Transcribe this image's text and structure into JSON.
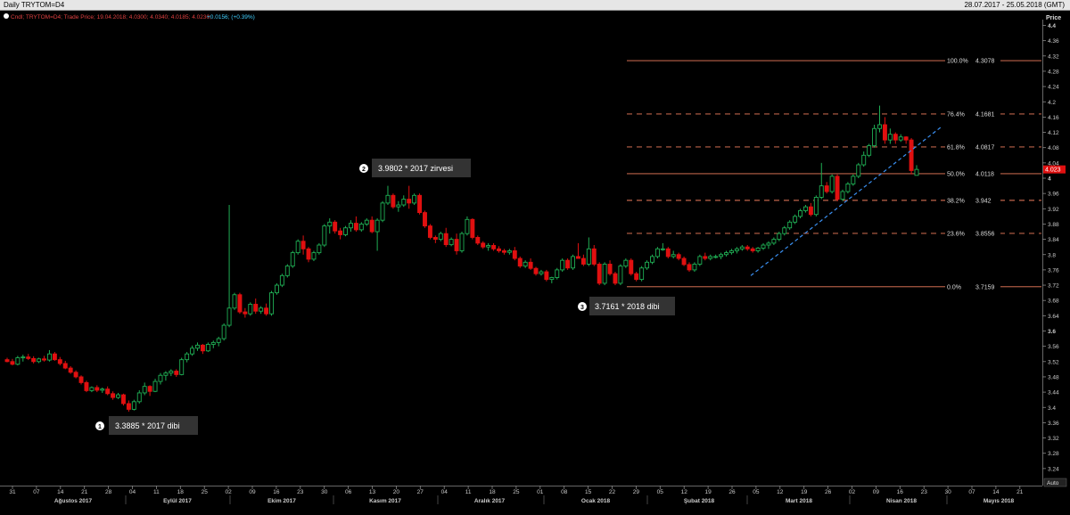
{
  "window": {
    "title": "Daily TRYTOM=D4",
    "date_range": "28.07.2017 - 25.05.2018 (GMT)"
  },
  "legend_line": {
    "prefix": "Cndl; TRYTOM=D4; Trade Price; 19.04.2018; 4.0300; 4.0340; 4.0185; 4.0230;",
    "change": "+0.0156; (+0.39%)"
  },
  "axis": {
    "price_label": "Price",
    "auto_label": "Auto",
    "last_price_tag": "4.023",
    "price_ticks": [
      "4.4",
      "4.36",
      "4.32",
      "4.28",
      "4.24",
      "4.2",
      "4.16",
      "4.12",
      "4.08",
      "4.04",
      "4",
      "3.96",
      "3.92",
      "3.88",
      "3.84",
      "3.8",
      "3.76",
      "3.72",
      "3.68",
      "3.64",
      "3.6",
      "3.56",
      "3.52",
      "3.48",
      "3.44",
      "3.4",
      "3.36",
      "3.32",
      "3.28",
      "3.24"
    ],
    "date_ticks": [
      "31",
      "07",
      "14",
      "21",
      "28",
      "04",
      "11",
      "18",
      "25",
      "02",
      "09",
      "16",
      "23",
      "30",
      "06",
      "13",
      "20",
      "27",
      "04",
      "11",
      "18",
      "25",
      "01",
      "08",
      "15",
      "22",
      "29",
      "05",
      "12",
      "19",
      "26",
      "05",
      "12",
      "19",
      "26",
      "02",
      "09",
      "16",
      "23",
      "30",
      "07",
      "14",
      "21"
    ],
    "month_labels": [
      "Ağustos 2017",
      "Eylül 2017",
      "Ekim 2017",
      "Kasım 2017",
      "Aralık 2017",
      "Ocak 2018",
      "Şubat 2018",
      "Mart 2018",
      "Nisan 2018",
      "Mayıs 2018"
    ]
  },
  "colors": {
    "up": "#1fae54",
    "down": "#e01010",
    "fib": "#f07e5e",
    "trend": "#3a8ff0",
    "background": "#000000"
  },
  "annotations": [
    {
      "num": "1",
      "text": "3.3885 * 2017 dibi"
    },
    {
      "num": "2",
      "text": "3.9802 * 2017 zirvesi"
    },
    {
      "num": "3",
      "text": "3.7161 * 2018 dibi"
    }
  ],
  "chart_data": {
    "type": "candlestick",
    "ylim": [
      3.22,
      4.42
    ],
    "y_axis": "Price",
    "fib_levels": [
      {
        "pct": "100.0%",
        "value": "4.3078",
        "style": "solid"
      },
      {
        "pct": "76.4%",
        "value": "4.1681",
        "style": "dashed"
      },
      {
        "pct": "61.8%",
        "value": "4.0817",
        "style": "dashed"
      },
      {
        "pct": "50.0%",
        "value": "4.0118",
        "style": "solid"
      },
      {
        "pct": "38.2%",
        "value": "3.942",
        "style": "dashed"
      },
      {
        "pct": "23.6%",
        "value": "3.8556",
        "style": "dashed"
      },
      {
        "pct": "0.0%",
        "value": "3.7159",
        "style": "solid"
      }
    ],
    "trend_line": {
      "from": {
        "day": "2018-03-08",
        "price": 3.745
      },
      "to": {
        "day": "2018-04-23",
        "price": 4.135
      }
    },
    "candles": [
      [
        3.525,
        3.53,
        3.518,
        3.52
      ],
      [
        3.52,
        3.527,
        3.51,
        3.513
      ],
      [
        3.513,
        3.535,
        3.51,
        3.53
      ],
      [
        3.53,
        3.538,
        3.52,
        3.532
      ],
      [
        3.532,
        3.54,
        3.524,
        3.528
      ],
      [
        3.528,
        3.534,
        3.515,
        3.52
      ],
      [
        3.52,
        3.53,
        3.516,
        3.527
      ],
      [
        3.527,
        3.535,
        3.52,
        3.524
      ],
      [
        3.524,
        3.55,
        3.52,
        3.54
      ],
      [
        3.54,
        3.545,
        3.522,
        3.525
      ],
      [
        3.525,
        3.532,
        3.51,
        3.515
      ],
      [
        3.515,
        3.522,
        3.5,
        3.503
      ],
      [
        3.503,
        3.508,
        3.488,
        3.492
      ],
      [
        3.492,
        3.497,
        3.476,
        3.48
      ],
      [
        3.48,
        3.484,
        3.46,
        3.465
      ],
      [
        3.465,
        3.47,
        3.44,
        3.444
      ],
      [
        3.444,
        3.455,
        3.44,
        3.452
      ],
      [
        3.452,
        3.458,
        3.44,
        3.445
      ],
      [
        3.445,
        3.452,
        3.438,
        3.448
      ],
      [
        3.448,
        3.455,
        3.432,
        3.436
      ],
      [
        3.436,
        3.442,
        3.42,
        3.426
      ],
      [
        3.426,
        3.438,
        3.422,
        3.433
      ],
      [
        3.433,
        3.436,
        3.405,
        3.41
      ],
      [
        3.41,
        3.418,
        3.389,
        3.395
      ],
      [
        3.395,
        3.42,
        3.392,
        3.415
      ],
      [
        3.415,
        3.445,
        3.41,
        3.438
      ],
      [
        3.438,
        3.465,
        3.432,
        3.455
      ],
      [
        3.455,
        3.458,
        3.43,
        3.442
      ],
      [
        3.442,
        3.475,
        3.44,
        3.468
      ],
      [
        3.468,
        3.49,
        3.46,
        3.484
      ],
      [
        3.484,
        3.495,
        3.47,
        3.49
      ],
      [
        3.49,
        3.5,
        3.482,
        3.495
      ],
      [
        3.495,
        3.5,
        3.48,
        3.486
      ],
      [
        3.486,
        3.53,
        3.484,
        3.525
      ],
      [
        3.525,
        3.545,
        3.518,
        3.54
      ],
      [
        3.54,
        3.562,
        3.535,
        3.555
      ],
      [
        3.555,
        3.57,
        3.548,
        3.563
      ],
      [
        3.563,
        3.566,
        3.54,
        3.548
      ],
      [
        3.548,
        3.57,
        3.545,
        3.565
      ],
      [
        3.565,
        3.575,
        3.555,
        3.57
      ],
      [
        3.57,
        3.585,
        3.56,
        3.58
      ],
      [
        3.58,
        3.62,
        3.575,
        3.615
      ],
      [
        3.615,
        3.93,
        3.61,
        3.66
      ],
      [
        3.66,
        3.7,
        3.655,
        3.695
      ],
      [
        3.695,
        3.7,
        3.645,
        3.65
      ],
      [
        3.65,
        3.66,
        3.635,
        3.645
      ],
      [
        3.645,
        3.675,
        3.64,
        3.67
      ],
      [
        3.67,
        3.685,
        3.645,
        3.652
      ],
      [
        3.652,
        3.665,
        3.645,
        3.66
      ],
      [
        3.66,
        3.672,
        3.64,
        3.645
      ],
      [
        3.645,
        3.705,
        3.64,
        3.7
      ],
      [
        3.7,
        3.725,
        3.695,
        3.72
      ],
      [
        3.72,
        3.75,
        3.715,
        3.745
      ],
      [
        3.745,
        3.775,
        3.74,
        3.77
      ],
      [
        3.77,
        3.81,
        3.765,
        3.805
      ],
      [
        3.805,
        3.84,
        3.8,
        3.835
      ],
      [
        3.835,
        3.85,
        3.8,
        3.815
      ],
      [
        3.815,
        3.82,
        3.78,
        3.788
      ],
      [
        3.788,
        3.81,
        3.783,
        3.805
      ],
      [
        3.805,
        3.83,
        3.8,
        3.825
      ],
      [
        3.825,
        3.88,
        3.82,
        3.875
      ],
      [
        3.875,
        3.895,
        3.855,
        3.885
      ],
      [
        3.885,
        3.89,
        3.855,
        3.862
      ],
      [
        3.862,
        3.87,
        3.84,
        3.852
      ],
      [
        3.852,
        3.875,
        3.848,
        3.87
      ],
      [
        3.87,
        3.89,
        3.86,
        3.882
      ],
      [
        3.882,
        3.9,
        3.86,
        3.865
      ],
      [
        3.865,
        3.885,
        3.86,
        3.88
      ],
      [
        3.88,
        3.895,
        3.875,
        3.89
      ],
      [
        3.89,
        3.9,
        3.856,
        3.86
      ],
      [
        3.86,
        3.895,
        3.81,
        3.89
      ],
      [
        3.89,
        3.94,
        3.885,
        3.935
      ],
      [
        3.935,
        3.98,
        3.93,
        3.955
      ],
      [
        3.955,
        3.96,
        3.92,
        3.925
      ],
      [
        3.925,
        3.94,
        3.912,
        3.93
      ],
      [
        3.93,
        3.955,
        3.925,
        3.945
      ],
      [
        3.945,
        3.98,
        3.92,
        3.935
      ],
      [
        3.935,
        3.96,
        3.93,
        3.955
      ],
      [
        3.955,
        3.96,
        3.905,
        3.91
      ],
      [
        3.91,
        3.915,
        3.87,
        3.875
      ],
      [
        3.875,
        3.88,
        3.84,
        3.845
      ],
      [
        3.845,
        3.85,
        3.83,
        3.84
      ],
      [
        3.84,
        3.86,
        3.835,
        3.855
      ],
      [
        3.855,
        3.87,
        3.82,
        3.826
      ],
      [
        3.826,
        3.845,
        3.822,
        3.84
      ],
      [
        3.84,
        3.855,
        3.8,
        3.81
      ],
      [
        3.81,
        3.86,
        3.805,
        3.855
      ],
      [
        3.855,
        3.9,
        3.85,
        3.892
      ],
      [
        3.892,
        3.895,
        3.84,
        3.845
      ],
      [
        3.845,
        3.85,
        3.825,
        3.83
      ],
      [
        3.83,
        3.835,
        3.815,
        3.82
      ],
      [
        3.82,
        3.83,
        3.81,
        3.824
      ],
      [
        3.824,
        3.83,
        3.81,
        3.815
      ],
      [
        3.815,
        3.822,
        3.805,
        3.81
      ],
      [
        3.81,
        3.815,
        3.8,
        3.806
      ],
      [
        3.806,
        3.815,
        3.8,
        3.81
      ],
      [
        3.81,
        3.82,
        3.785,
        3.79
      ],
      [
        3.79,
        3.795,
        3.765,
        3.77
      ],
      [
        3.77,
        3.785,
        3.765,
        3.78
      ],
      [
        3.78,
        3.79,
        3.76,
        3.764
      ],
      [
        3.764,
        3.768,
        3.745,
        3.75
      ],
      [
        3.75,
        3.76,
        3.745,
        3.755
      ],
      [
        3.755,
        3.76,
        3.73,
        3.735
      ],
      [
        3.735,
        3.742,
        3.725,
        3.74
      ],
      [
        3.74,
        3.765,
        3.735,
        3.76
      ],
      [
        3.76,
        3.79,
        3.755,
        3.785
      ],
      [
        3.785,
        3.79,
        3.76,
        3.765
      ],
      [
        3.765,
        3.8,
        3.76,
        3.795
      ],
      [
        3.795,
        3.83,
        3.79,
        3.79
      ],
      [
        3.79,
        3.8,
        3.77,
        3.775
      ],
      [
        3.775,
        3.845,
        3.77,
        3.815
      ],
      [
        3.815,
        3.825,
        3.77,
        3.775
      ],
      [
        3.775,
        3.78,
        3.72,
        3.725
      ],
      [
        3.725,
        3.78,
        3.72,
        3.775
      ],
      [
        3.775,
        3.785,
        3.745,
        3.75
      ],
      [
        3.75,
        3.755,
        3.72,
        3.725
      ],
      [
        3.725,
        3.775,
        3.72,
        3.77
      ],
      [
        3.77,
        3.79,
        3.765,
        3.785
      ],
      [
        3.785,
        3.79,
        3.745,
        3.75
      ],
      [
        3.75,
        3.755,
        3.73,
        3.735
      ],
      [
        3.735,
        3.77,
        3.73,
        3.765
      ],
      [
        3.765,
        3.785,
        3.76,
        3.78
      ],
      [
        3.78,
        3.8,
        3.775,
        3.795
      ],
      [
        3.795,
        3.82,
        3.79,
        3.815
      ],
      [
        3.815,
        3.83,
        3.81,
        3.815
      ],
      [
        3.815,
        3.82,
        3.79,
        3.795
      ],
      [
        3.795,
        3.81,
        3.79,
        3.8
      ],
      [
        3.8,
        3.805,
        3.785,
        3.79
      ],
      [
        3.79,
        3.795,
        3.77,
        3.774
      ],
      [
        3.774,
        3.78,
        3.755,
        3.76
      ],
      [
        3.76,
        3.78,
        3.755,
        3.775
      ],
      [
        3.775,
        3.8,
        3.77,
        3.795
      ],
      [
        3.795,
        3.805,
        3.785,
        3.79
      ],
      [
        3.79,
        3.8,
        3.785,
        3.795
      ],
      [
        3.795,
        3.8,
        3.79,
        3.795
      ],
      [
        3.795,
        3.805,
        3.788,
        3.8
      ],
      [
        3.8,
        3.81,
        3.795,
        3.805
      ],
      [
        3.805,
        3.815,
        3.8,
        3.81
      ],
      [
        3.81,
        3.82,
        3.803,
        3.815
      ],
      [
        3.815,
        3.825,
        3.81,
        3.82
      ],
      [
        3.82,
        3.825,
        3.81,
        3.815
      ],
      [
        3.815,
        3.82,
        3.805,
        3.81
      ],
      [
        3.81,
        3.82,
        3.805,
        3.817
      ],
      [
        3.817,
        3.83,
        3.812,
        3.825
      ],
      [
        3.825,
        3.835,
        3.815,
        3.83
      ],
      [
        3.83,
        3.845,
        3.825,
        3.84
      ],
      [
        3.84,
        3.86,
        3.835,
        3.855
      ],
      [
        3.855,
        3.875,
        3.85,
        3.87
      ],
      [
        3.87,
        3.89,
        3.865,
        3.885
      ],
      [
        3.885,
        3.905,
        3.88,
        3.9
      ],
      [
        3.9,
        3.92,
        3.895,
        3.915
      ],
      [
        3.915,
        3.93,
        3.91,
        3.925
      ],
      [
        3.925,
        3.935,
        3.9,
        3.905
      ],
      [
        3.905,
        3.955,
        3.9,
        3.95
      ],
      [
        3.95,
        4.04,
        3.945,
        3.98
      ],
      [
        3.98,
        3.99,
        3.96,
        3.965
      ],
      [
        3.965,
        4.01,
        3.96,
        4.005
      ],
      [
        4.005,
        4.01,
        3.94,
        3.945
      ],
      [
        3.945,
        3.97,
        3.94,
        3.965
      ],
      [
        3.965,
        3.99,
        3.96,
        3.985
      ],
      [
        3.985,
        4.01,
        3.98,
        4.005
      ],
      [
        4.005,
        4.04,
        4.0,
        4.035
      ],
      [
        4.035,
        4.07,
        4.03,
        4.06
      ],
      [
        4.06,
        4.09,
        4.055,
        4.085
      ],
      [
        4.085,
        4.14,
        4.08,
        4.13
      ],
      [
        4.13,
        4.19,
        4.12,
        4.14
      ],
      [
        4.14,
        4.16,
        4.09,
        4.1
      ],
      [
        4.1,
        4.13,
        4.09,
        4.115
      ],
      [
        4.115,
        4.12,
        4.09,
        4.1
      ],
      [
        4.1,
        4.115,
        4.095,
        4.108
      ],
      [
        4.108,
        4.11,
        4.09,
        4.1
      ],
      [
        4.1,
        4.105,
        4.01,
        4.02
      ],
      [
        4.0074,
        4.034,
        4.0185,
        4.023
      ]
    ]
  }
}
